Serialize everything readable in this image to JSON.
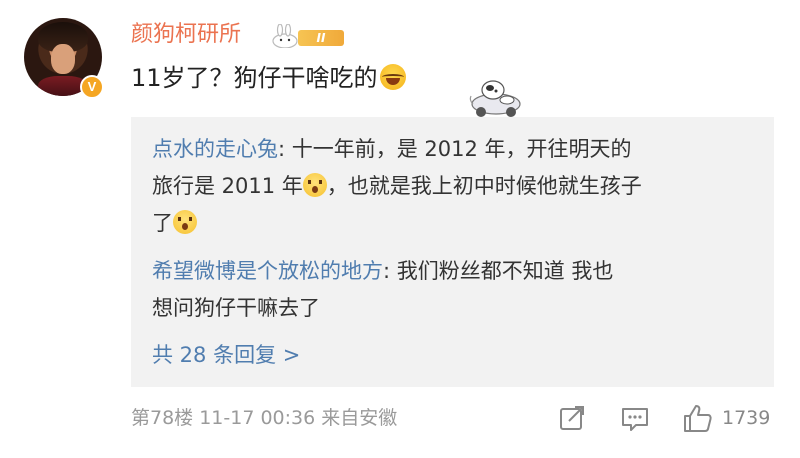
{
  "post": {
    "username": "颜狗柯研所",
    "level_badge": "II",
    "comment_text": "11岁了？狗仔干啥吃的",
    "comment_emoji": "laughing-tears-icon",
    "verified_badge": "V",
    "colors": {
      "username": "#eb7350",
      "reply_user": "#507daf",
      "badge": "#f5a623"
    }
  },
  "replies": [
    {
      "user": "点水的走心兔",
      "line1": ": 十一年前，是 2012 年，开往明天的",
      "line2a": "旅行是 2011 年",
      "line2b": "，也就是我上初中时候他就生孩子",
      "line3": "了"
    },
    {
      "user": "希望微博是个放松的地方",
      "line1": ": 我们粉丝都不知道 我也",
      "line2": "想问狗仔干嘛去了"
    }
  ],
  "more_replies": "共 28 条回复 >",
  "footer": {
    "meta": "第78楼  11-17 00:36  来自安徽",
    "like_count": "1739",
    "icons": [
      "share-icon",
      "comment-icon",
      "like-icon"
    ]
  }
}
